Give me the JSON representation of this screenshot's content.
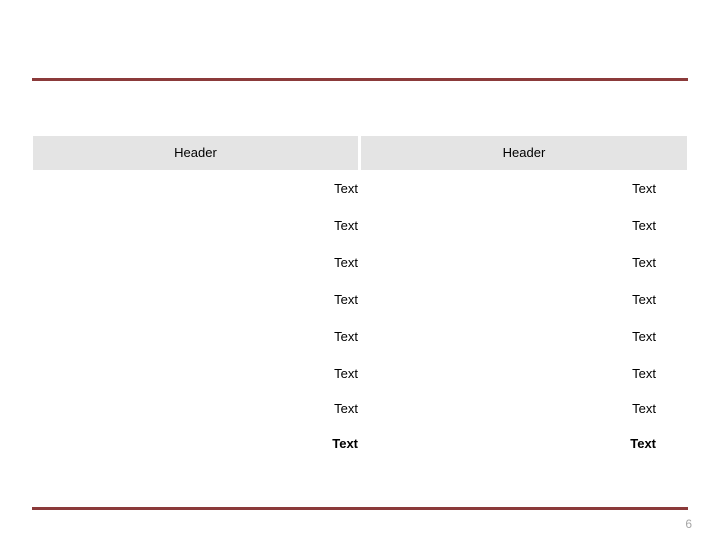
{
  "slide": {
    "title": "",
    "page_number": "6",
    "accent_color": "#8B3A3A",
    "header_fill": "#E4E4E4",
    "page_number_color": "#A6A6A6"
  },
  "table": {
    "columns": [
      {
        "header": "Header"
      },
      {
        "header": "Header"
      }
    ],
    "rows": [
      {
        "cells": [
          "Text",
          "Text"
        ],
        "bold": false
      },
      {
        "cells": [
          "Text",
          "Text"
        ],
        "bold": false
      },
      {
        "cells": [
          "Text",
          "Text"
        ],
        "bold": false
      },
      {
        "cells": [
          "Text",
          "Text"
        ],
        "bold": false
      },
      {
        "cells": [
          "Text",
          "Text"
        ],
        "bold": false
      },
      {
        "cells": [
          "Text",
          "Text"
        ],
        "bold": false
      },
      {
        "cells": [
          "Text",
          "Text"
        ],
        "bold": false
      },
      {
        "cells": [
          "Text",
          "Text"
        ],
        "bold": true
      }
    ]
  }
}
